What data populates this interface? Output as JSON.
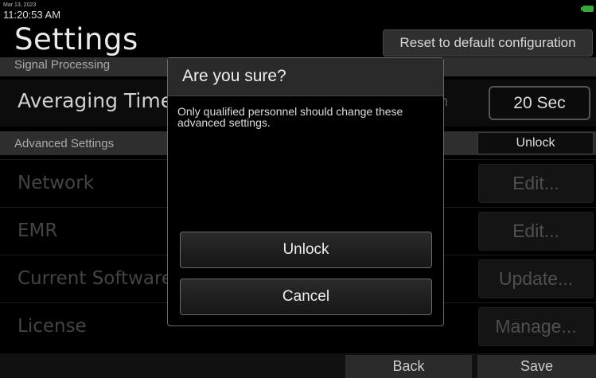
{
  "status": {
    "date": "Mar 13, 2023",
    "time": "11:20:53 AM",
    "battery_color": "#3aa53a"
  },
  "header": {
    "title": "Settings",
    "reset_label": "Reset to default configuration"
  },
  "signal_processing": {
    "header": "Signal Processing",
    "averaging_label": "Averaging Time",
    "partial_unit_text": "n",
    "averaging_value": "20 Sec"
  },
  "advanced": {
    "header": "Advanced Settings",
    "unlock_label": "Unlock",
    "rows": [
      {
        "label": "Network",
        "button": "Edit..."
      },
      {
        "label": "EMR",
        "button": "Edit..."
      },
      {
        "label": "Current Software",
        "button": "Update..."
      },
      {
        "label": "License",
        "button": "Manage..."
      }
    ]
  },
  "footer": {
    "back_label": "Back",
    "save_label": "Save"
  },
  "dialog": {
    "title": "Are you sure?",
    "message": "Only qualified personnel should change these advanced settings.",
    "confirm_label": "Unlock",
    "cancel_label": "Cancel"
  }
}
